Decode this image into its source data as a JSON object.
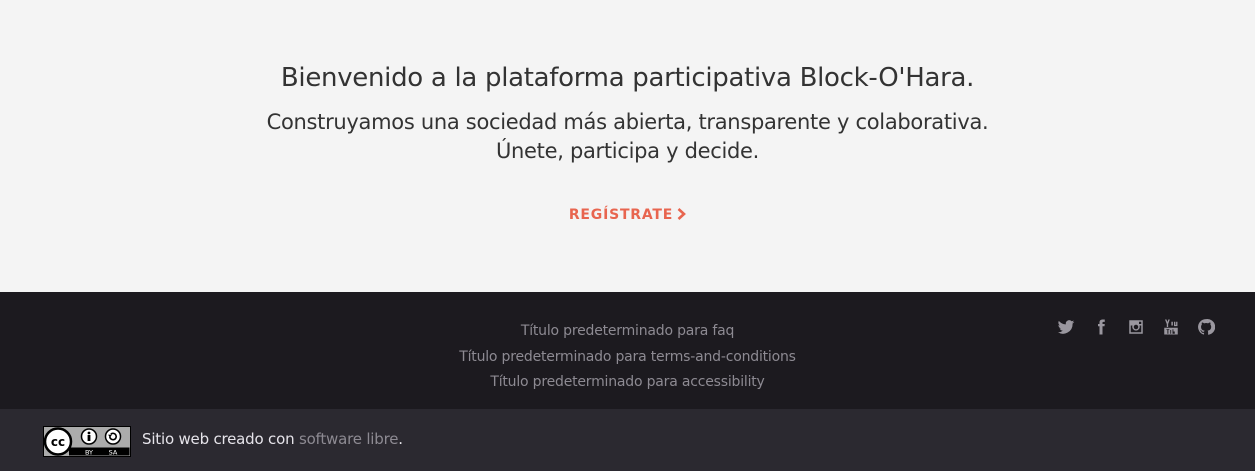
{
  "hero": {
    "title": "Bienvenido a la plataforma participativa Block-O'Hara.",
    "subtitle_line1": "Construyamos una sociedad más abierta, transparente y colaborativa.",
    "subtitle_line2": "Únete, participa y decide.",
    "cta_label": "REGÍSTRATE",
    "cta_icon": "chevron-right-icon",
    "accent_color": "#e8654f"
  },
  "footer": {
    "links": [
      "Título predeterminado para faq",
      "Título predeterminado para terms-and-conditions",
      "Título predeterminado para accessibility"
    ],
    "social_icons": [
      "twitter-icon",
      "facebook-icon",
      "instagram-icon",
      "youtube-icon",
      "github-icon"
    ]
  },
  "subfooter": {
    "license_badge_icon": "creative-commons-by-sa-icon",
    "license_badge_text": {
      "cc": "cc",
      "by": "BY",
      "sa": "SA"
    },
    "credit_text": "Sitio web creado con ",
    "credit_link": "software libre",
    "credit_end": "."
  }
}
